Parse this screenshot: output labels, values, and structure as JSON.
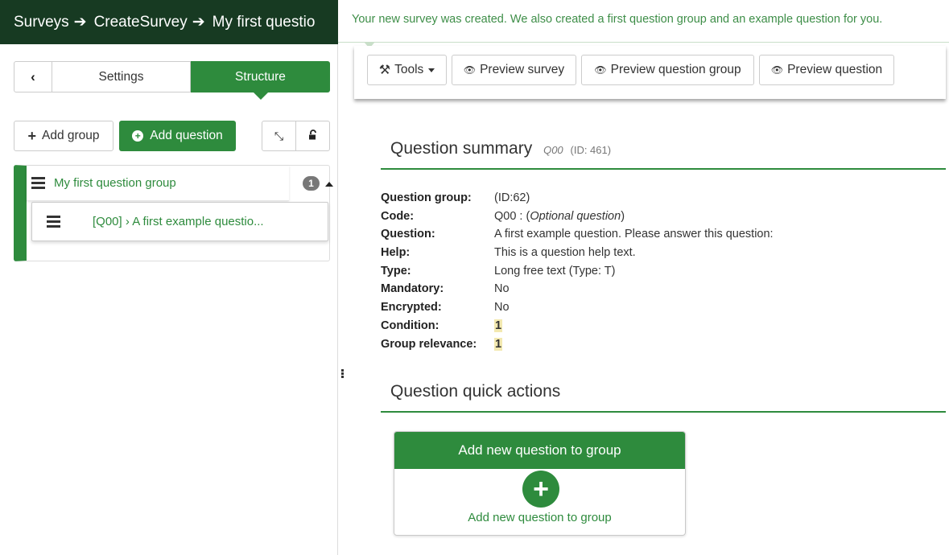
{
  "breadcrumb": {
    "items": [
      "Surveys",
      "CreateSurvey",
      "My first questio"
    ]
  },
  "notification": "Your new survey was created. We also created a first question group and an example question for you.",
  "sidebar": {
    "tab_settings": "Settings",
    "tab_structure": "Structure",
    "add_group": "Add group",
    "add_question": "Add question",
    "group": {
      "label": "My first question group",
      "count": "1",
      "question_label": "[Q00] › A first example questio..."
    }
  },
  "toolbar": {
    "tools": "Tools",
    "preview_survey": "Preview survey",
    "preview_group": "Preview question group",
    "preview_question": "Preview question"
  },
  "summary": {
    "title": "Question summary",
    "code": "Q00",
    "id": "(ID: 461)",
    "rows": [
      {
        "label": "Question group:",
        "value": "(ID:62)"
      },
      {
        "label": "Code:",
        "value": "Q00 : ("
      },
      {
        "label": "Question:",
        "value": "A first example question. Please answer this question:"
      },
      {
        "label": "Help:",
        "value": "This is a question help text."
      },
      {
        "label": "Type:",
        "value": "Long free text (Type: T)"
      },
      {
        "label": "Mandatory:",
        "value": "No"
      },
      {
        "label": "Encrypted:",
        "value": "No"
      },
      {
        "label": "Condition:",
        "value": "1"
      },
      {
        "label": "Group relevance:",
        "value": "1"
      }
    ],
    "code_optional": "Optional question",
    "code_close": ")"
  },
  "quick_actions": {
    "title": "Question quick actions",
    "panel_header": "Add new question to group",
    "panel_label": "Add new question to group"
  },
  "colors": {
    "brand_green": "#2e8b3d",
    "topbar_dark": "#173a22",
    "highlight": "#f3e9b0"
  },
  "icons": [
    "arrow-right-icon",
    "chevron-left-icon",
    "plus-icon",
    "plus-circle-icon",
    "collapse-icon",
    "unlock-icon",
    "hamburger-icon",
    "caret-up-icon",
    "wrench-icon",
    "eye-icon",
    "caret-down-icon"
  ]
}
